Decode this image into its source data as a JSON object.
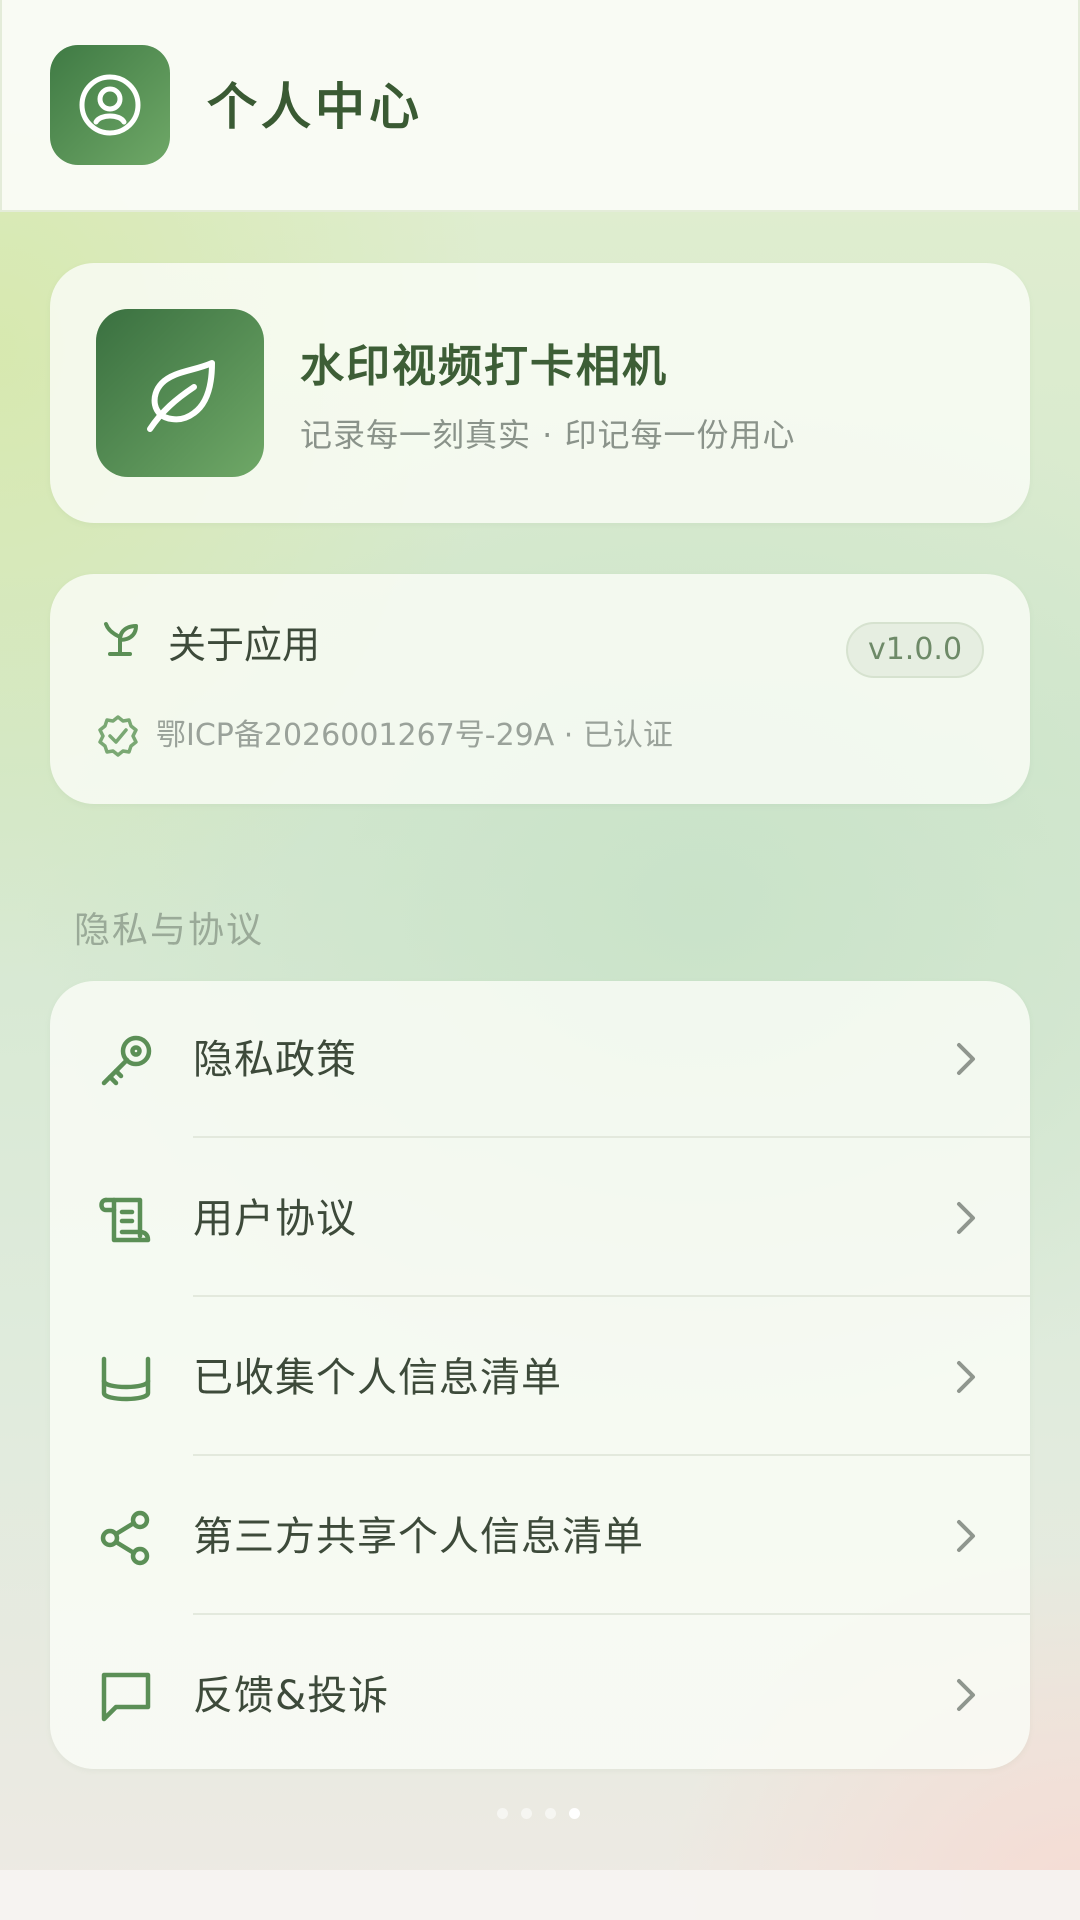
{
  "header": {
    "title": "个人中心",
    "icon": "user-circle-icon"
  },
  "app": {
    "name": "水印视频打卡相机",
    "slogan": "记录每一刻真实 · 印记每一份用心",
    "icon": "leaf-icon"
  },
  "about": {
    "title": "关于应用",
    "icon": "sprout-icon",
    "version": "v1.0.0",
    "icp": "鄂ICP备2026001267号-29A · 已认证",
    "icp_icon": "verified-check-icon"
  },
  "privacy_section": {
    "title": "隐私与协议",
    "items": [
      {
        "label": "隐私政策",
        "icon": "key-icon"
      },
      {
        "label": "用户协议",
        "icon": "scroll-icon"
      },
      {
        "label": "已收集个人信息清单",
        "icon": "database-icon"
      },
      {
        "label": "第三方共享个人信息清单",
        "icon": "share-icon"
      },
      {
        "label": "反馈&投诉",
        "icon": "chat-icon"
      }
    ]
  },
  "pager": {
    "count": 4,
    "active_index": 3
  },
  "colors": {
    "brand_green": "#4e8a4d",
    "title_green": "#3d5e36",
    "muted_text": "#9aa29a"
  }
}
